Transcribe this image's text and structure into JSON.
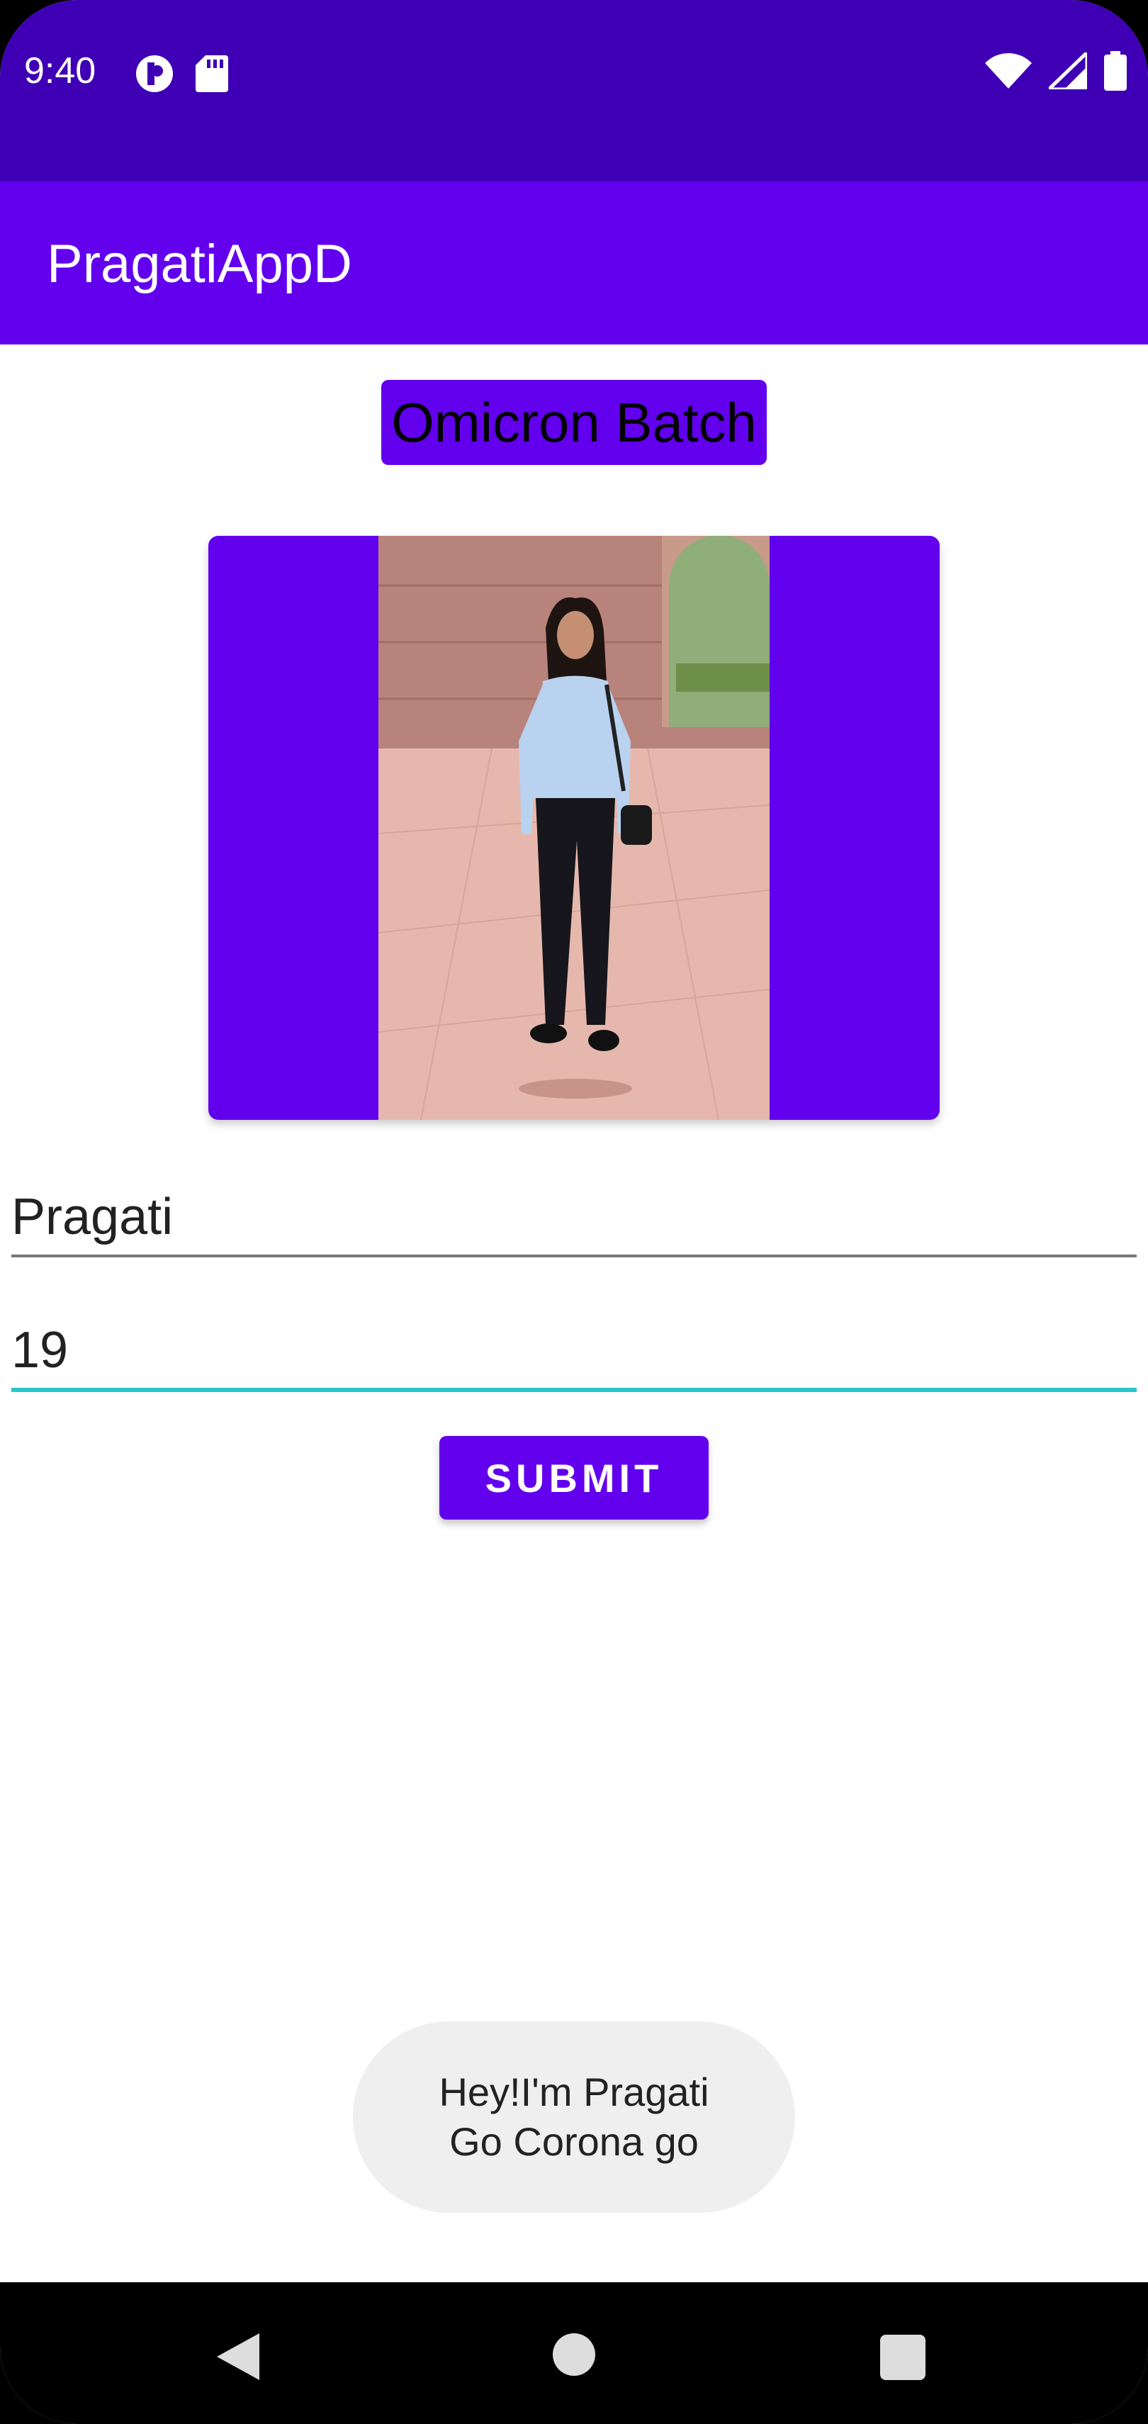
{
  "status_bar": {
    "time": "9:40",
    "left_icons": [
      "data-saver-icon",
      "sd-card-icon"
    ],
    "right_icons": [
      "wifi-icon",
      "signal-icon",
      "battery-icon"
    ]
  },
  "app_bar": {
    "title": "PragatiAppD"
  },
  "main": {
    "batch_label": "Omicron Batch",
    "name_input": {
      "value": "Pragati"
    },
    "age_input": {
      "value": "19"
    },
    "submit_label": "SUBMIT"
  },
  "toast": {
    "line1": "Hey!I'm Pragati",
    "line2": "Go Corona go"
  },
  "nav_bar": {
    "icons": [
      "back-icon",
      "home-icon",
      "recents-icon"
    ]
  },
  "colors": {
    "status_bar": "#3f00b5",
    "primary": "#6200ee",
    "focus_underline": "#26c6c6",
    "toast_bg": "#efefef"
  }
}
